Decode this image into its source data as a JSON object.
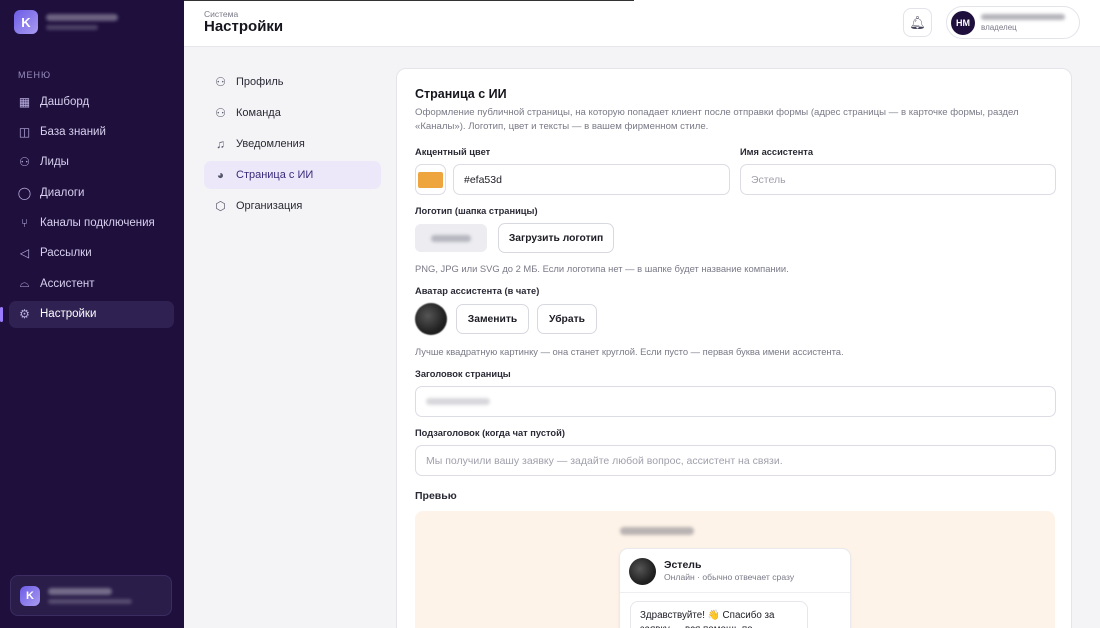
{
  "sidebar": {
    "logo_letter": "K",
    "menu_title": "МЕНЮ",
    "items": [
      {
        "label": "Дашборд",
        "icon": "grid-icon"
      },
      {
        "label": "База знаний",
        "icon": "book-icon"
      },
      {
        "label": "Лиды",
        "icon": "user-icon"
      },
      {
        "label": "Диалоги",
        "icon": "chat-icon"
      },
      {
        "label": "Каналы подключения",
        "icon": "network-icon"
      },
      {
        "label": "Рассылки",
        "icon": "megaphone-icon"
      },
      {
        "label": "Ассистент",
        "icon": "bot-icon"
      },
      {
        "label": "Настройки",
        "icon": "gear-icon"
      }
    ],
    "active_index": 7
  },
  "topbar": {
    "crumb": "Система",
    "title": "Настройки",
    "avatar_initials": "НМ",
    "role": "владелец"
  },
  "settings_nav": {
    "items": [
      {
        "label": "Профиль",
        "icon": "user-icon"
      },
      {
        "label": "Команда",
        "icon": "team-icon"
      },
      {
        "label": "Уведомления",
        "icon": "bell-icon"
      },
      {
        "label": "Страница с ИИ",
        "icon": "palette-icon"
      },
      {
        "label": "Организация",
        "icon": "box-icon"
      }
    ],
    "active_index": 3
  },
  "page": {
    "title": "Страница с ИИ",
    "description": "Оформление публичной страницы, на которую попадает клиент после отправки формы (адрес страницы — в карточке формы, раздел «Каналы»). Логотип, цвет и тексты — в вашем фирменном стиле.",
    "accent": {
      "label": "Акцентный цвет",
      "value": "#efa53d",
      "color": "#efa53d"
    },
    "assistant_name": {
      "label": "Имя ассистента",
      "placeholder": "Эстель"
    },
    "logo": {
      "label": "Логотип (шапка страницы)",
      "upload_button": "Загрузить логотип",
      "hint": "PNG, JPG или SVG до 2 МБ. Если логотипа нет — в шапке будет название компании."
    },
    "avatar": {
      "label": "Аватар ассистента (в чате)",
      "replace_button": "Заменить",
      "remove_button": "Убрать",
      "hint": "Лучше квадратную картинку — она станет круглой. Если пусто — первая буква имени ассистента."
    },
    "page_heading": {
      "label": "Заголовок страницы"
    },
    "subheading": {
      "label": "Подзаголовок (когда чат пустой)",
      "placeholder": "Мы получили вашу заявку — задайте любой вопрос, ассистент на связи."
    },
    "preview": {
      "label": "Превью",
      "assistant_name": "Эстель",
      "status": "Онлайн · обычно отвечает сразу",
      "greeting": "Здравствуйте! 👋 Спасибо за заявку — вся помощь по вопросам у нас."
    }
  }
}
